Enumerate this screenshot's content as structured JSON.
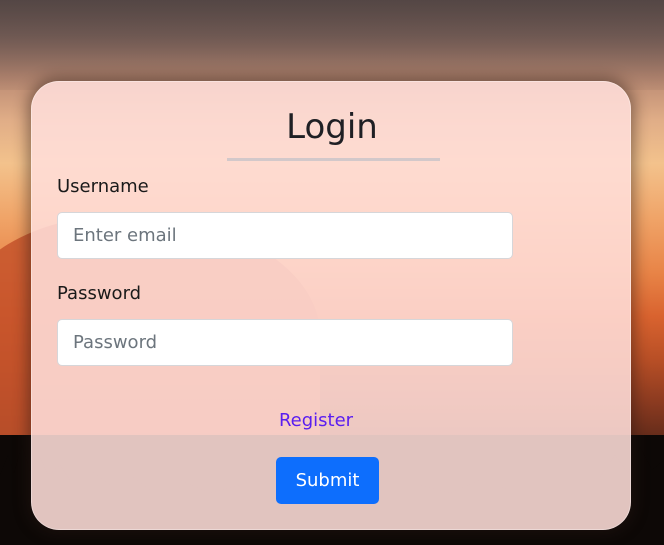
{
  "login": {
    "title": "Login",
    "username_label": "Username",
    "username_placeholder": "Enter email",
    "password_label": "Password",
    "password_placeholder": "Password",
    "register_link": "Register",
    "submit_label": "Submit"
  },
  "colors": {
    "submit_button": "#0d6efd",
    "register_link": "#5a1ef0",
    "card_background": "#ffdeda"
  }
}
